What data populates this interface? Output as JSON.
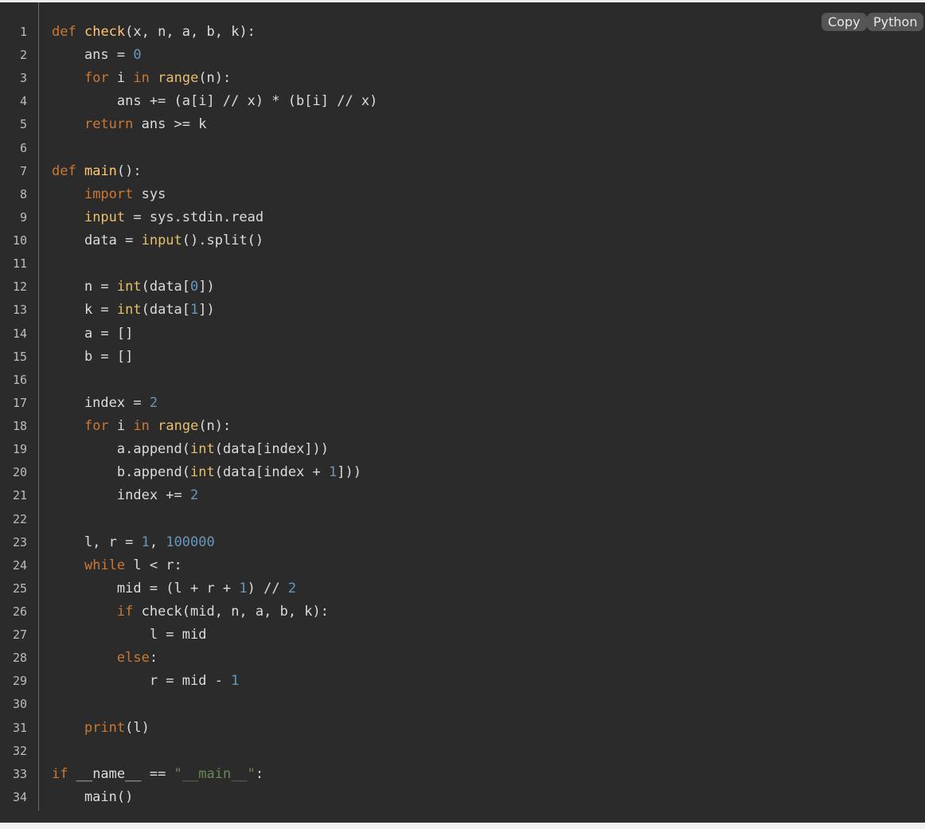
{
  "toolbar": {
    "copy_label": "Copy",
    "language_label": "Python"
  },
  "colors": {
    "background": "#2b2b2b",
    "keyword": "#cc7832",
    "function": "#ffc66d",
    "number": "#6897bb",
    "string": "#6a8759",
    "text": "#dcdcdc"
  },
  "code": {
    "language": "Python",
    "lines": [
      [
        [
          "kw",
          "def"
        ],
        [
          "t",
          " "
        ],
        [
          "fn",
          "check"
        ],
        [
          "t",
          "(x, n, a, b, k):"
        ]
      ],
      [
        [
          "t",
          "    ans = "
        ],
        [
          "num",
          "0"
        ]
      ],
      [
        [
          "t",
          "    "
        ],
        [
          "kw",
          "for"
        ],
        [
          "t",
          " i "
        ],
        [
          "kw",
          "in"
        ],
        [
          "t",
          " "
        ],
        [
          "bi",
          "range"
        ],
        [
          "t",
          "(n):"
        ]
      ],
      [
        [
          "t",
          "        ans += (a[i] // x) * (b[i] // x)"
        ]
      ],
      [
        [
          "t",
          "    "
        ],
        [
          "kw",
          "return"
        ],
        [
          "t",
          " ans >= k"
        ]
      ],
      [],
      [
        [
          "kw",
          "def"
        ],
        [
          "t",
          " "
        ],
        [
          "fn",
          "main"
        ],
        [
          "t",
          "():"
        ]
      ],
      [
        [
          "t",
          "    "
        ],
        [
          "kw",
          "import"
        ],
        [
          "t",
          " sys"
        ]
      ],
      [
        [
          "t",
          "    "
        ],
        [
          "bi",
          "input"
        ],
        [
          "t",
          " = sys.stdin.read"
        ]
      ],
      [
        [
          "t",
          "    data = "
        ],
        [
          "bi",
          "input"
        ],
        [
          "t",
          "().split()"
        ]
      ],
      [],
      [
        [
          "t",
          "    n = "
        ],
        [
          "bi",
          "int"
        ],
        [
          "t",
          "(data["
        ],
        [
          "num",
          "0"
        ],
        [
          "t",
          "])"
        ]
      ],
      [
        [
          "t",
          "    k = "
        ],
        [
          "bi",
          "int"
        ],
        [
          "t",
          "(data["
        ],
        [
          "num",
          "1"
        ],
        [
          "t",
          "])"
        ]
      ],
      [
        [
          "t",
          "    a = []"
        ]
      ],
      [
        [
          "t",
          "    b = []"
        ]
      ],
      [],
      [
        [
          "t",
          "    index = "
        ],
        [
          "num",
          "2"
        ]
      ],
      [
        [
          "t",
          "    "
        ],
        [
          "kw",
          "for"
        ],
        [
          "t",
          " i "
        ],
        [
          "kw",
          "in"
        ],
        [
          "t",
          " "
        ],
        [
          "bi",
          "range"
        ],
        [
          "t",
          "(n):"
        ]
      ],
      [
        [
          "t",
          "        a.append("
        ],
        [
          "bi",
          "int"
        ],
        [
          "t",
          "(data[index]))"
        ]
      ],
      [
        [
          "t",
          "        b.append("
        ],
        [
          "bi",
          "int"
        ],
        [
          "t",
          "(data[index + "
        ],
        [
          "num",
          "1"
        ],
        [
          "t",
          "]))"
        ]
      ],
      [
        [
          "t",
          "        index += "
        ],
        [
          "num",
          "2"
        ]
      ],
      [],
      [
        [
          "t",
          "    l, r = "
        ],
        [
          "num",
          "1"
        ],
        [
          "t",
          ", "
        ],
        [
          "num",
          "100000"
        ]
      ],
      [
        [
          "t",
          "    "
        ],
        [
          "kw",
          "while"
        ],
        [
          "t",
          " l < r:"
        ]
      ],
      [
        [
          "t",
          "        mid = (l + r + "
        ],
        [
          "num",
          "1"
        ],
        [
          "t",
          ") // "
        ],
        [
          "num",
          "2"
        ]
      ],
      [
        [
          "t",
          "        "
        ],
        [
          "kw",
          "if"
        ],
        [
          "t",
          " check(mid, n, a, b, k):"
        ]
      ],
      [
        [
          "t",
          "            l = mid"
        ]
      ],
      [
        [
          "t",
          "        "
        ],
        [
          "kw",
          "else"
        ],
        [
          "t",
          ":"
        ]
      ],
      [
        [
          "t",
          "            r = mid - "
        ],
        [
          "num",
          "1"
        ]
      ],
      [],
      [
        [
          "t",
          "    "
        ],
        [
          "kw",
          "print"
        ],
        [
          "t",
          "(l)"
        ]
      ],
      [],
      [
        [
          "kw",
          "if"
        ],
        [
          "t",
          " __name__ == "
        ],
        [
          "str",
          "\"__main__\""
        ],
        [
          "t",
          ":"
        ]
      ],
      [
        [
          "t",
          "    main()"
        ]
      ]
    ]
  }
}
